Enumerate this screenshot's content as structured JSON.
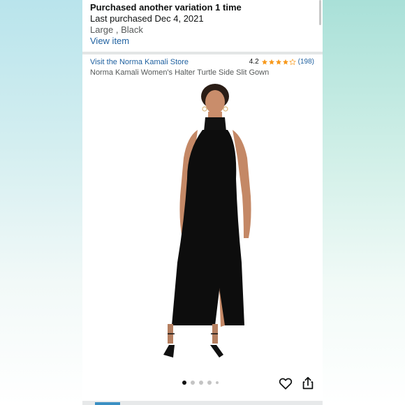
{
  "purchase_notice": {
    "title": "Purchased another variation 1 time",
    "last_purchased": "Last purchased Dec 4, 2021",
    "variant": "Large , Black",
    "view_item_label": "View item"
  },
  "product": {
    "store_link": "Visit the Norma Kamali Store",
    "rating_value": "4.2",
    "rating_stars": 4.2,
    "rating_count": "(198)",
    "title": "Norma Kamali Women's Halter Turtle Side Slit Gown"
  },
  "gallery": {
    "image_count": 5,
    "active_index": 0
  },
  "icons": {
    "star": "star-icon",
    "wishlist": "heart-icon",
    "share": "share-icon"
  },
  "colors": {
    "link": "#2162a1",
    "star": "#f79a1e",
    "text": "#0f1111",
    "secondary_text": "#565959"
  }
}
